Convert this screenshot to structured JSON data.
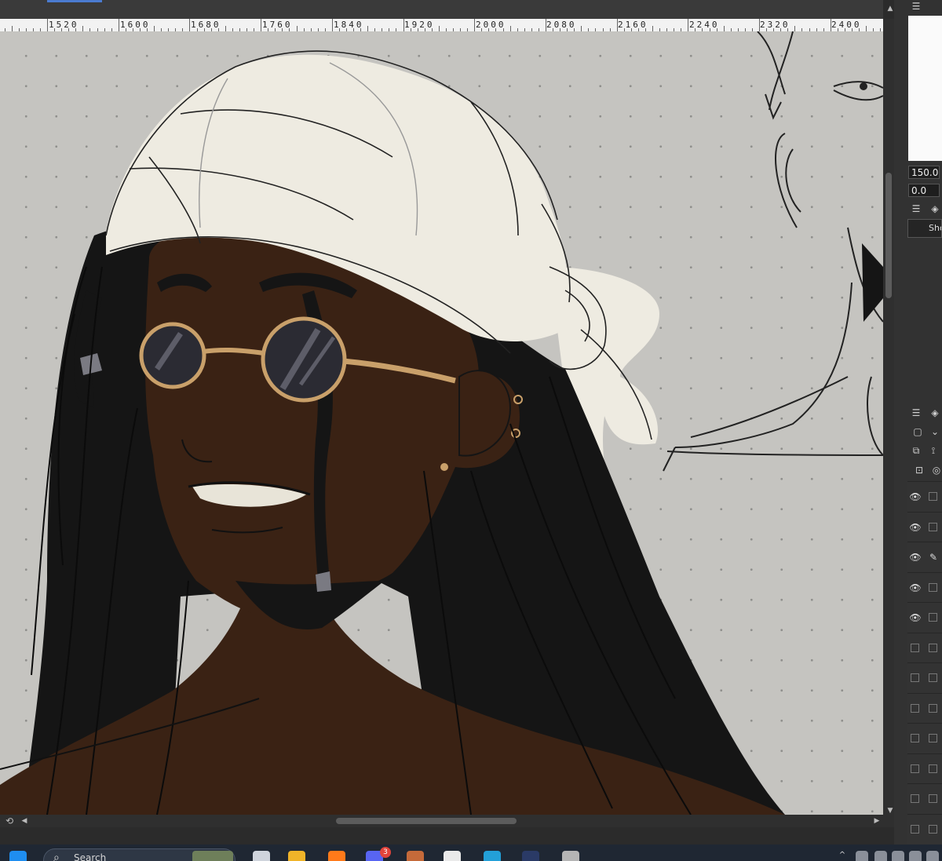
{
  "ruler": {
    "labels": [
      "1520",
      "1600",
      "1680",
      "1760",
      "1840",
      "1920",
      "2000",
      "2080",
      "2160",
      "2240",
      "2320",
      "2400"
    ]
  },
  "navigator": {
    "zoom_value": "150.0",
    "rotation_value": "0.0"
  },
  "layer_panel": {
    "search_placeholder": "Sho",
    "layers": [
      {
        "visible": true,
        "pen": false
      },
      {
        "visible": true,
        "pen": false
      },
      {
        "visible": true,
        "pen": true
      },
      {
        "visible": true,
        "pen": false
      },
      {
        "visible": true,
        "pen": false
      },
      {
        "visible": false,
        "pen": false
      },
      {
        "visible": false,
        "pen": false
      },
      {
        "visible": false,
        "pen": false
      },
      {
        "visible": false,
        "pen": false
      },
      {
        "visible": false,
        "pen": false
      },
      {
        "visible": false,
        "pen": false
      },
      {
        "visible": false,
        "pen": false
      }
    ]
  },
  "taskbar": {
    "search_label": "Search",
    "notification_count": "3"
  },
  "colors": {
    "canvas_bg": "#c5c4c0",
    "skin": "#3a2214",
    "hair": "#151515",
    "bandana": "#eeebe1",
    "glasses_frame": "#c9a06a"
  }
}
